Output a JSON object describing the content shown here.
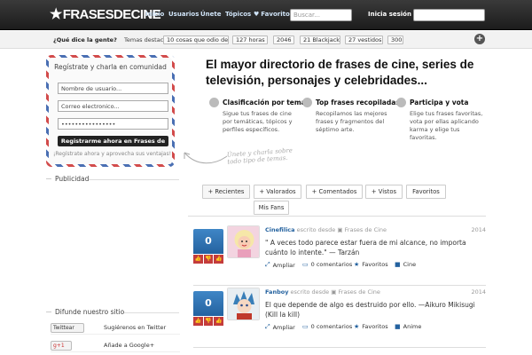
{
  "header": {
    "logo": "FRASESDECINE",
    "nav": [
      "Inicio",
      "Usuarios",
      "Únete",
      "Tópicos",
      "Favoritos"
    ],
    "search_placeholder": "Buscar...",
    "login_label": "Inicia sesión"
  },
  "subbar": {
    "question": "¿Qué dice la gente?",
    "trending_label": "Temas destacados",
    "tags": [
      "10 cosas que odio de ti",
      "127 horas",
      "2046",
      "21 Blackjack",
      "27 vestidos",
      "300"
    ],
    "add_icon": "plus-icon"
  },
  "register": {
    "title": "Regístrate y charla en comunidad",
    "username_placeholder": "Nombre de usuario...",
    "email_placeholder": "Correo electronico...",
    "password_value": "••••••••••••••••",
    "button": "Registrarme ahora en Frases de Cine",
    "note": "¡Regístrate ahora y aprovecha sus ventajas!"
  },
  "handwritten": {
    "line1": "Únete y charla sobre",
    "line2": "todo tipo de temas."
  },
  "sidebar": {
    "publicidad": "Publicidad",
    "difunde": "Difunde nuestro sitio",
    "shares": [
      {
        "button": "Twittear",
        "text": "Sugiérenos en Twitter"
      },
      {
        "button": "g+1",
        "text": "Añade a Google+"
      }
    ]
  },
  "hero": {
    "title": "El mayor directorio de frases de cine, series de televisión, personajes y celebridades...",
    "features": [
      {
        "title": "Clasificación por temas",
        "desc": "Sigue tus frases de cine por temáticas, tópicos y perfiles específicos."
      },
      {
        "title": "Top frases recopiladas",
        "desc": "Recopilamos las mejores frases y fragmentos del séptimo arte."
      },
      {
        "title": "Participa y vota",
        "desc": "Elige tus frases favoritas, vota por ellas aplicando karma y elige tus favoritas."
      }
    ]
  },
  "tabs": [
    "+ Recientes",
    "+ Valorados",
    "+ Comentados",
    "+ Vistos",
    "Favoritos",
    "Mis Fans"
  ],
  "posts": [
    {
      "votes": "0",
      "user": "Cinefilica",
      "meta": "escrito desde",
      "site": "Frases de Cine",
      "year": "2014",
      "quote": "\" A veces todo parece estar fuera de mi alcance, no importa cuánto lo intente.\" — Tarzán",
      "ampliar": "Ampliar",
      "comments": "0 comentarios",
      "favoritos": "Favoritos",
      "category": "Cine"
    },
    {
      "votes": "0",
      "user": "Fanboy",
      "meta": "escrito desde",
      "site": "Frases de Cine",
      "year": "2014",
      "quote": "El que depende de algo es destruido por ello. —Aikuro Mikisugi (Kill la kill)",
      "ampliar": "Ampliar",
      "comments": "0 comentarios",
      "favoritos": "Favoritos",
      "category": "Anime"
    }
  ],
  "colors": {
    "accent": "#24629f",
    "vote_red": "#c43c3c",
    "header": "#1c1c1c"
  }
}
